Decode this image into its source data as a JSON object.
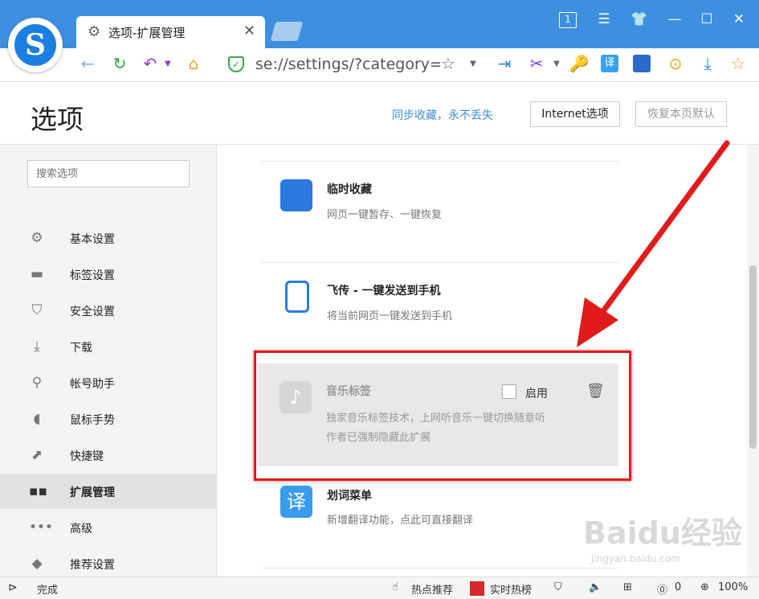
{
  "browser": {
    "tab_title": "选项-扩展管理",
    "address": "se://settings/?category=e",
    "tab_badge": "1"
  },
  "header": {
    "title": "选项",
    "sync_link": "同步收藏，永不丢失",
    "internet_options": "Internet选项",
    "restore_default": "恢复本页默认"
  },
  "search": {
    "placeholder": "搜索选项"
  },
  "sidebar": {
    "items": [
      {
        "label": "基本设置",
        "icon": "gear-icon"
      },
      {
        "label": "标签设置",
        "icon": "tab-icon"
      },
      {
        "label": "安全设置",
        "icon": "shield-icon"
      },
      {
        "label": "下载",
        "icon": "download-icon"
      },
      {
        "label": "帐号助手",
        "icon": "key-icon"
      },
      {
        "label": "鼠标手势",
        "icon": "mouse-icon"
      },
      {
        "label": "快捷键",
        "icon": "arrow-icon"
      },
      {
        "label": "扩展管理",
        "icon": "grid-icon"
      },
      {
        "label": "高级",
        "icon": "dots-icon"
      },
      {
        "label": "推荐设置",
        "icon": "diamond-icon"
      }
    ],
    "active_index": 7
  },
  "extensions": [
    {
      "name": "临时收藏",
      "desc1": "网页一键暂存、一键恢复",
      "desc2": ""
    },
    {
      "name": "飞传 - 一键发送到手机",
      "desc1": "将当前网页一键发送到手机",
      "desc2": ""
    },
    {
      "name": "音乐标签",
      "desc1": "独家音乐标签技术，上网听音乐一键切换随意听",
      "desc2": "作者已强制隐藏此扩展",
      "enable_label": "启用"
    },
    {
      "name": "划词菜单",
      "desc1": "新增翻译功能，点此可直接翻译",
      "desc2": "",
      "icon_char": "译"
    }
  ],
  "status": {
    "done": "完成",
    "hot": "热点推荐",
    "realtime": "实时热榜",
    "ad_count": "0",
    "zoom": "100%"
  },
  "watermark": {
    "text": "Baidu经验",
    "sub": "jingyan.baidu.com"
  },
  "colors": {
    "accent": "#3d8fe0",
    "highlight": "#e11b1b"
  }
}
